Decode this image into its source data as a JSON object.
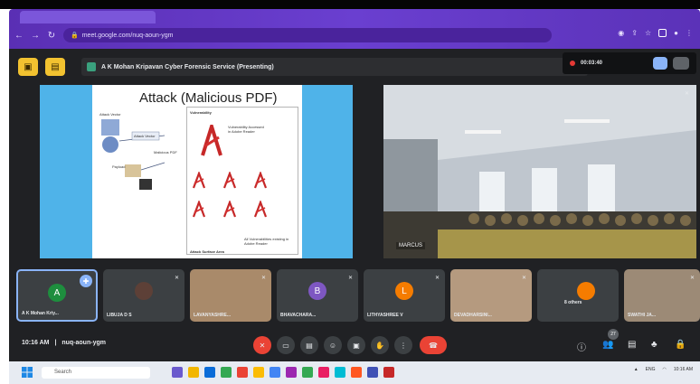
{
  "browser": {
    "url": "meet.google.com/nuq-aoun-ygm"
  },
  "meeting": {
    "presenting_text": "A K Mohan Kripavan Cyber Forensic Service (Presenting)",
    "recording_time": "00:03:40",
    "meeting_code": "nuq-aoun-ygm",
    "time": "10:16 AM",
    "separator": "|",
    "participant_count_badge": "27"
  },
  "slide": {
    "title": "Attack (Malicious PDF)",
    "labels": {
      "vulnerability": "Vulnerability",
      "attack_vector": "Attack Vector",
      "exploit_text": "Vulnerability Accessed in Adobe Reader",
      "malicious": "Malicious PDF",
      "surface": "Attack Surface Area",
      "payload": "Payload",
      "all_pdf_text": "All Vulnerabilities existing in Adobe Reader"
    }
  },
  "camera": {
    "label": "MARCUS"
  },
  "tiles": [
    {
      "name": "A K Mohan Kriy...",
      "avatar_letter": "A",
      "avatar_color": "#1e8e3e",
      "kind": "avatar",
      "active": true
    },
    {
      "name": "LIBUJA D S",
      "kind": "photo-avatar"
    },
    {
      "name": "LAVANYASHRE...",
      "kind": "video"
    },
    {
      "name": "BHAVACHARA...",
      "avatar_letter": "B",
      "avatar_color": "#7e57c2",
      "kind": "avatar"
    },
    {
      "name": "LITHYASHREE V",
      "avatar_letter": "L",
      "avatar_color": "#f57c00",
      "kind": "avatar"
    },
    {
      "name": "DEVADHARSINI...",
      "kind": "video"
    },
    {
      "name": "8 others",
      "kind": "others"
    },
    {
      "name": "SWATHI JA...",
      "kind": "video"
    }
  ],
  "taskbar": {
    "search_placeholder": "Search",
    "tray_lang": "ENG",
    "tray_time": "10:16 AM"
  },
  "colors": {
    "meet_bg": "#202124",
    "chrome_purple": "#5a2fb4",
    "presenting_yellow": "#f2c230",
    "hangup_red": "#ea4335",
    "slide_blue": "#4fb3e9"
  }
}
